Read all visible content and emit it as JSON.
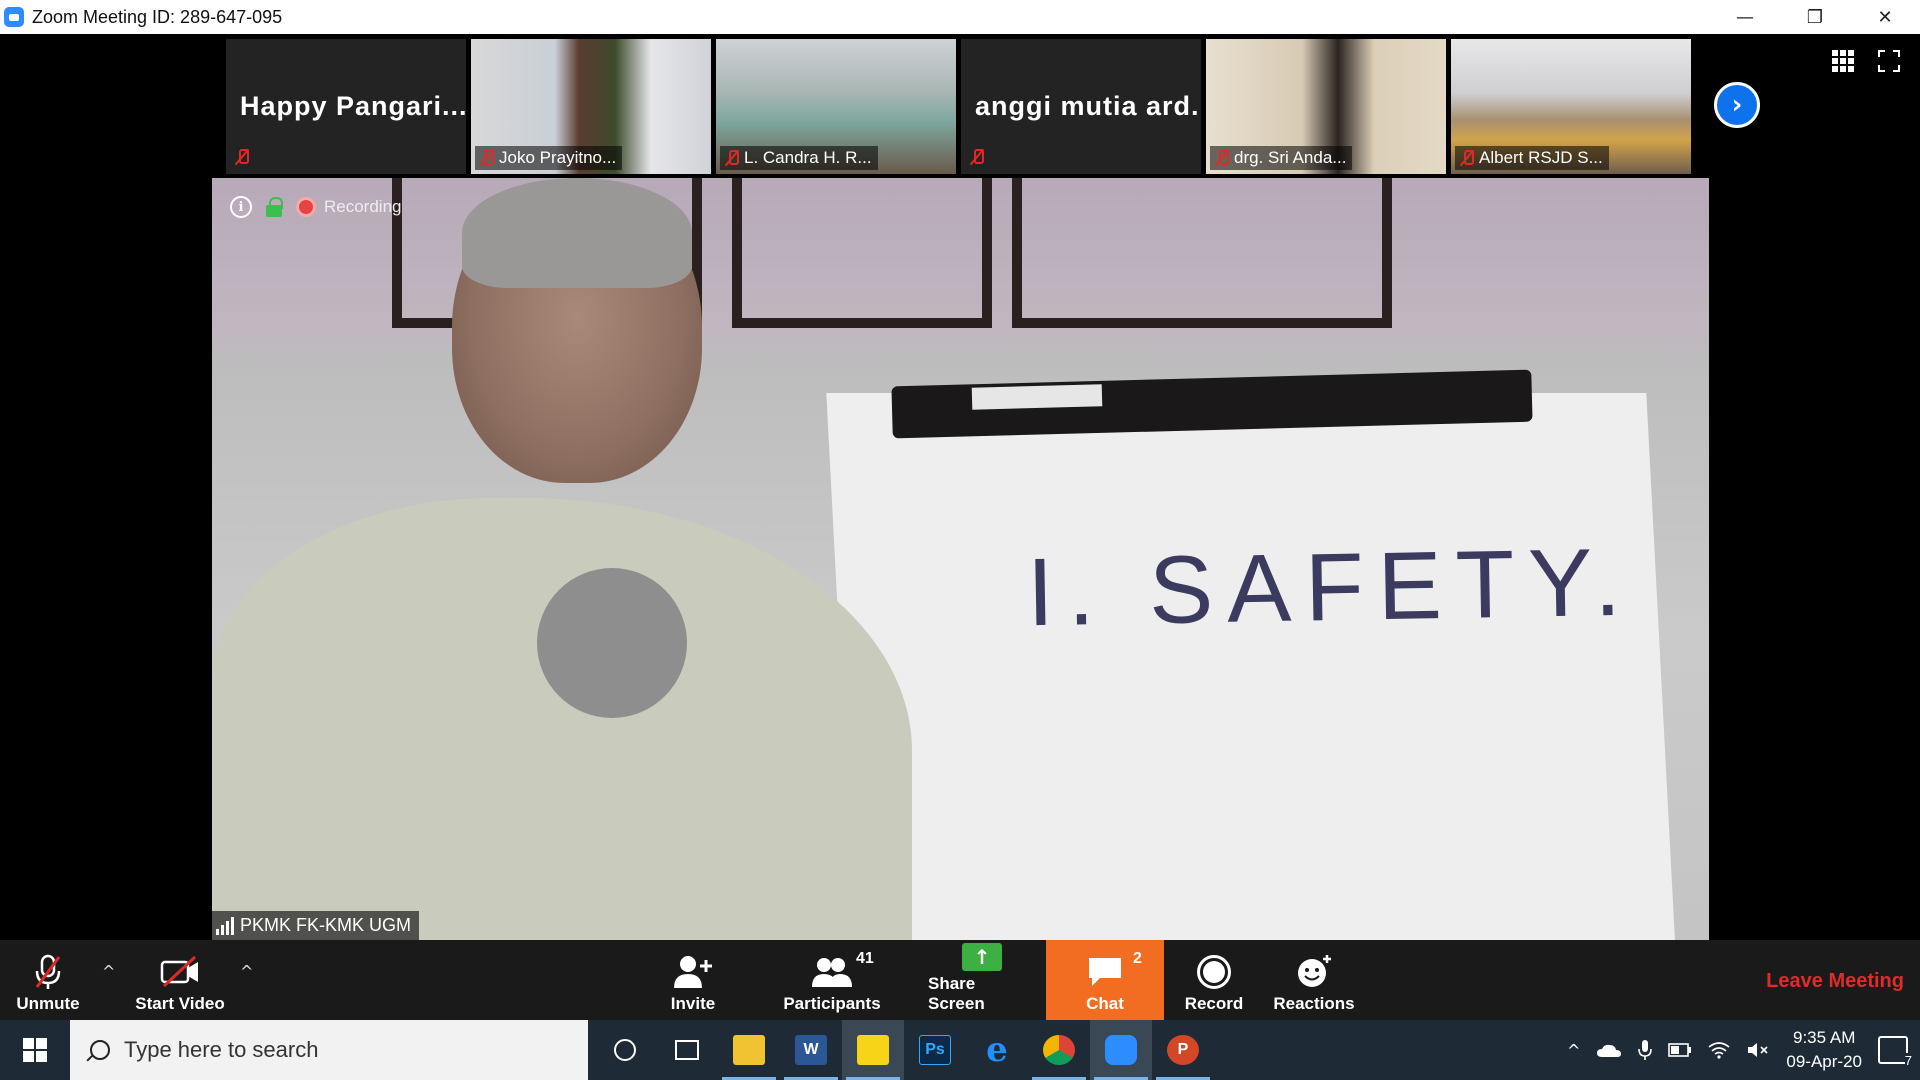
{
  "window": {
    "title": "Zoom Meeting ID: 289-647-095",
    "minimize": "—",
    "restore": "❐",
    "close": "✕"
  },
  "thumbnails": [
    {
      "name": "Happy  Pangari...",
      "video": false
    },
    {
      "name": "Joko Prayitno...",
      "video": true
    },
    {
      "name": "L. Candra H. R...",
      "video": true
    },
    {
      "name": "anggi  mutia  ard...",
      "video": false
    },
    {
      "name": "drg. Sri Anda...",
      "video": true
    },
    {
      "name": "Albert RSJD S...",
      "video": true
    }
  ],
  "next_arrow": "›",
  "main_video": {
    "recording_label": "Recording",
    "info_glyph": "i",
    "speaker_name": "PKMK FK-KMK UGM",
    "board_text": "I. SAFETY."
  },
  "toolbar": {
    "unmute": "Unmute",
    "start_video": "Start Video",
    "invite": "Invite",
    "participants": "Participants",
    "participants_count": "41",
    "share_screen": "Share Screen",
    "chat": "Chat",
    "chat_count": "2",
    "record": "Record",
    "reactions": "Reactions",
    "leave": "Leave Meeting",
    "caret": "^",
    "share_arrow": "↑"
  },
  "taskbar": {
    "search_placeholder": "Type here to search",
    "word_label": "W",
    "ps_label": "Ps",
    "ppt_label": "P",
    "edge_label": "e",
    "time": "9:35 AM",
    "date": "09-Apr-20",
    "notifications": "7",
    "tray_up": "^"
  },
  "colors": {
    "accent": "#2d8cff",
    "chat_active": "#f26d21",
    "leave": "#e02b2b",
    "mic_muted": "#e02828"
  }
}
